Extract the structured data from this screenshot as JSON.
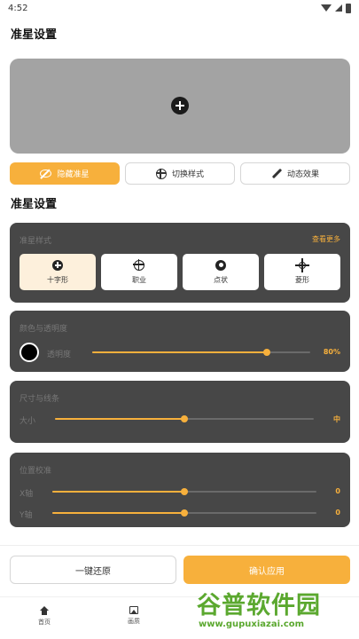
{
  "status_bar": {
    "time": "4:52"
  },
  "page_title": "准星设置",
  "actions": {
    "hide": "隐藏准星",
    "switch": "切换样式",
    "dynamic": "动态效果"
  },
  "section_title": "准星设置",
  "style_card": {
    "label": "准星样式",
    "more": "查看更多",
    "options": [
      {
        "label": "十字形",
        "icon": "plus-circle-icon",
        "selected": true
      },
      {
        "label": "职业",
        "icon": "scope-icon",
        "selected": false
      },
      {
        "label": "点状",
        "icon": "dot-icon",
        "selected": false
      },
      {
        "label": "菱形",
        "icon": "star-cross-icon",
        "selected": false
      }
    ]
  },
  "color_card": {
    "label": "颜色与透明度",
    "opacity_label": "透明度",
    "swatch_color": "#000000",
    "opacity_value": "80%",
    "opacity_level": 0.8
  },
  "size_card": {
    "label": "尺寸与线条",
    "size_label": "大小",
    "size_value": "中",
    "size_level": 0.5
  },
  "position_card": {
    "label": "位置校准",
    "x_label": "X轴",
    "x_value": "0",
    "x_level": 0.5,
    "y_label": "Y轴",
    "y_value": "0",
    "y_level": 0.5
  },
  "buttons": {
    "reset": "一键还原",
    "apply": "确认应用"
  },
  "nav": {
    "home": "首页",
    "quality": "画质"
  },
  "watermark": {
    "title": "谷普软件园",
    "url": "www.gupuxiazai.com"
  },
  "colors": {
    "accent": "#f7b03c",
    "card": "#474747",
    "preview": "#a3a3a3",
    "watermark": "#5ba82f"
  }
}
